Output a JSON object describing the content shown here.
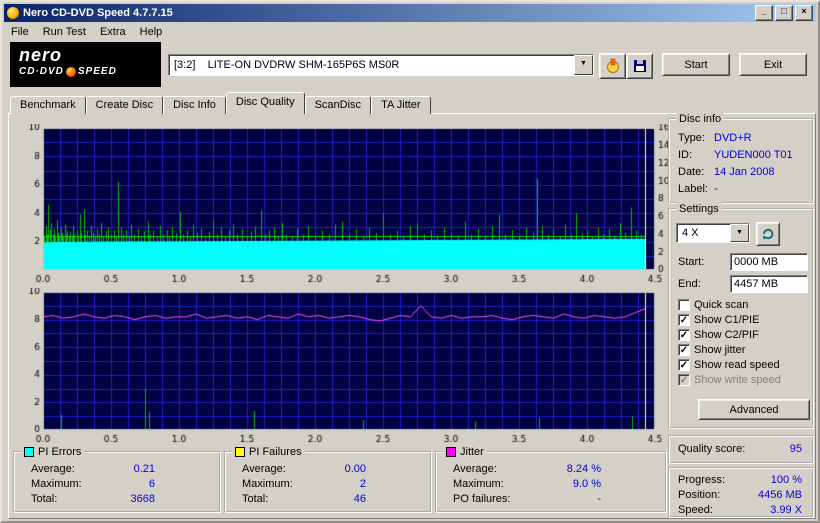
{
  "window": {
    "title": "Nero CD-DVD Speed 4.7.7.15",
    "controls": {
      "minimize": "_",
      "maximize": "□",
      "close": "×"
    }
  },
  "icons": {
    "dropdown": "▼",
    "check": "✓"
  },
  "menu": {
    "items": [
      "File",
      "Run Test",
      "Extra",
      "Help"
    ]
  },
  "logo": {
    "line1": "nero",
    "line2a": "CD·DVD",
    "line2b": "SPEED"
  },
  "toolbar": {
    "drive": "[3:2]    LITE-ON DVDRW SHM-165P6S MS0R",
    "start": "Start",
    "exit": "Exit"
  },
  "tabs": {
    "items": [
      "Benchmark",
      "Create Disc",
      "Disc Info",
      "Disc Quality",
      "ScanDisc",
      "TA Jitter"
    ],
    "active": "Disc Quality"
  },
  "disc_info": {
    "title": "Disc info",
    "rows": [
      [
        "Type:",
        "DVD+R"
      ],
      [
        "ID:",
        "YUDEN000 T01"
      ],
      [
        "Date:",
        "14 Jan 2008"
      ],
      [
        "Label:",
        "-"
      ]
    ]
  },
  "settings": {
    "title": "Settings",
    "speed": "4 X",
    "start_label": "Start:",
    "start_value": "0000 MB",
    "end_label": "End:",
    "end_value": "4457 MB",
    "checkboxes": [
      {
        "label": "Quick scan",
        "checked": false,
        "disabled": false
      },
      {
        "label": "Show C1/PIE",
        "checked": true,
        "disabled": false
      },
      {
        "label": "Show C2/PIF",
        "checked": true,
        "disabled": false
      },
      {
        "label": "Show jitter",
        "checked": true,
        "disabled": false
      },
      {
        "label": "Show read speed",
        "checked": true,
        "disabled": false
      },
      {
        "label": "Show write speed",
        "checked": true,
        "disabled": true
      }
    ],
    "advanced": "Advanced"
  },
  "quality": {
    "label": "Quality score:",
    "value": "95"
  },
  "progress": {
    "rows": [
      [
        "Progress:",
        "100 %"
      ],
      [
        "Position:",
        "4456 MB"
      ],
      [
        "Speed:",
        "3.99 X"
      ]
    ]
  },
  "stats": [
    {
      "title": "PI Errors",
      "swatch": "#00ffff",
      "rows": [
        [
          "Average:",
          "0.21"
        ],
        [
          "Maximum:",
          "6"
        ],
        [
          "Total:",
          "3668"
        ]
      ]
    },
    {
      "title": "PI Failures",
      "swatch": "#ffff00",
      "rows": [
        [
          "Average:",
          "0.00"
        ],
        [
          "Maximum:",
          "2"
        ],
        [
          "Total:",
          "46"
        ]
      ]
    },
    {
      "title": "Jitter",
      "swatch": "#ff00ff",
      "rows": [
        [
          "Average:",
          "8.24 %"
        ],
        [
          "Maximum:",
          "9.0 %"
        ],
        [
          "PO failures:",
          "-"
        ]
      ]
    }
  ],
  "chart_data": [
    {
      "type": "bar",
      "title": "PI Errors / read speed",
      "x_range": [
        0,
        4.5
      ],
      "y_left_range": [
        0,
        10
      ],
      "y_right_range": [
        0,
        16
      ],
      "x_ticks": [
        "0.0",
        "0.5",
        "1.0",
        "1.5",
        "2.0",
        "2.5",
        "3.0",
        "3.5",
        "4.0",
        "4.5"
      ],
      "left_ticks": [
        "10",
        "8",
        "6",
        "4",
        "2"
      ],
      "right_ticks": [
        "16",
        "14",
        "12",
        "10",
        "8",
        "6",
        "4",
        "2",
        "0"
      ],
      "grid_x_step": 0.125,
      "grid_y_step": 1,
      "colors": {
        "bg": "#000042",
        "grid": "#2020c8",
        "spike": "#00c000",
        "area": "#00ffff",
        "speed_line": "#00e400",
        "end_line": "#ffff99"
      },
      "scan_end_x": 4.43,
      "speed_line_y": 2.4,
      "read_speed_top": [
        [
          0,
          1.95
        ],
        [
          0.5,
          2.0
        ],
        [
          1.5,
          2.05
        ],
        [
          2.5,
          2.1
        ],
        [
          3.5,
          2.15
        ],
        [
          4.43,
          2.2
        ]
      ],
      "spikes": [
        [
          0.01,
          2.4
        ],
        [
          0.02,
          3.1
        ],
        [
          0.03,
          2.5
        ],
        [
          0.04,
          4.6
        ],
        [
          0.05,
          2.8
        ],
        [
          0.06,
          3.3
        ],
        [
          0.07,
          2.5
        ],
        [
          0.08,
          2.9
        ],
        [
          0.09,
          2.4
        ],
        [
          0.1,
          3.5
        ],
        [
          0.11,
          2.6
        ],
        [
          0.12,
          2.4
        ],
        [
          0.13,
          3.0
        ],
        [
          0.14,
          2.6
        ],
        [
          0.15,
          2.4
        ],
        [
          0.16,
          3.2
        ],
        [
          0.17,
          2.5
        ],
        [
          0.18,
          2.8
        ],
        [
          0.19,
          2.4
        ],
        [
          0.2,
          2.7
        ],
        [
          0.21,
          2.4
        ],
        [
          0.22,
          3.1
        ],
        [
          0.23,
          2.5
        ],
        [
          0.25,
          2.8
        ],
        [
          0.26,
          2.4
        ],
        [
          0.27,
          3.9
        ],
        [
          0.28,
          2.6
        ],
        [
          0.3,
          4.3
        ],
        [
          0.31,
          2.5
        ],
        [
          0.32,
          2.8
        ],
        [
          0.34,
          2.4
        ],
        [
          0.35,
          3.1
        ],
        [
          0.37,
          2.6
        ],
        [
          0.38,
          2.4
        ],
        [
          0.4,
          2.9
        ],
        [
          0.41,
          2.5
        ],
        [
          0.43,
          3.3
        ],
        [
          0.44,
          2.4
        ],
        [
          0.46,
          2.7
        ],
        [
          0.48,
          3.0
        ],
        [
          0.5,
          2.5
        ],
        [
          0.52,
          2.8
        ],
        [
          0.54,
          2.4
        ],
        [
          0.55,
          6.2
        ],
        [
          0.57,
          3.0
        ],
        [
          0.59,
          2.5
        ],
        [
          0.61,
          2.8
        ],
        [
          0.63,
          2.4
        ],
        [
          0.65,
          3.2
        ],
        [
          0.67,
          2.5
        ],
        [
          0.7,
          2.9
        ],
        [
          0.72,
          2.4
        ],
        [
          0.74,
          2.7
        ],
        [
          0.77,
          3.4
        ],
        [
          0.79,
          2.5
        ],
        [
          0.81,
          2.8
        ],
        [
          0.84,
          2.4
        ],
        [
          0.86,
          3.1
        ],
        [
          0.88,
          2.5
        ],
        [
          0.91,
          2.8
        ],
        [
          0.93,
          2.4
        ],
        [
          0.95,
          3.0
        ],
        [
          0.98,
          2.6
        ],
        [
          1.01,
          4.1
        ],
        [
          1.03,
          2.5
        ],
        [
          1.06,
          2.8
        ],
        [
          1.08,
          2.4
        ],
        [
          1.1,
          3.2
        ],
        [
          1.13,
          2.6
        ],
        [
          1.16,
          2.9
        ],
        [
          1.19,
          2.4
        ],
        [
          1.22,
          2.7
        ],
        [
          1.25,
          3.5
        ],
        [
          1.28,
          2.5
        ],
        [
          1.31,
          3.0
        ],
        [
          1.34,
          2.4
        ],
        [
          1.37,
          2.8
        ],
        [
          1.4,
          3.2
        ],
        [
          1.43,
          2.5
        ],
        [
          1.46,
          2.9
        ],
        [
          1.5,
          2.4
        ],
        [
          1.53,
          2.7
        ],
        [
          1.56,
          3.1
        ],
        [
          1.6,
          4.2
        ],
        [
          1.63,
          2.5
        ],
        [
          1.66,
          2.8
        ],
        [
          1.7,
          3.0
        ],
        [
          1.73,
          2.4
        ],
        [
          1.76,
          3.3
        ],
        [
          1.79,
          2.5
        ],
        [
          1.83,
          2.4
        ],
        [
          1.87,
          2.9
        ],
        [
          1.91,
          2.5
        ],
        [
          1.95,
          3.1
        ],
        [
          2.0,
          2.4
        ],
        [
          2.05,
          2.8
        ],
        [
          2.1,
          2.5
        ],
        [
          2.15,
          3.2
        ],
        [
          2.2,
          3.4
        ],
        [
          2.25,
          2.5
        ],
        [
          2.3,
          2.9
        ],
        [
          2.35,
          2.4
        ],
        [
          2.4,
          3.0
        ],
        [
          2.45,
          2.6
        ],
        [
          2.5,
          4.0
        ],
        [
          2.55,
          2.5
        ],
        [
          2.6,
          2.8
        ],
        [
          2.65,
          2.4
        ],
        [
          2.7,
          3.1
        ],
        [
          2.75,
          3.3
        ],
        [
          2.8,
          2.5
        ],
        [
          2.85,
          2.8
        ],
        [
          2.9,
          2.4
        ],
        [
          2.95,
          3.0
        ],
        [
          3.0,
          2.6
        ],
        [
          3.05,
          2.4
        ],
        [
          3.1,
          3.4
        ],
        [
          3.15,
          2.5
        ],
        [
          3.2,
          2.9
        ],
        [
          3.25,
          2.4
        ],
        [
          3.3,
          3.1
        ],
        [
          3.35,
          3.9
        ],
        [
          3.4,
          2.5
        ],
        [
          3.45,
          2.8
        ],
        [
          3.5,
          2.4
        ],
        [
          3.55,
          3.0
        ],
        [
          3.6,
          2.6
        ],
        [
          3.63,
          6.4
        ],
        [
          3.67,
          3.1
        ],
        [
          3.71,
          2.5
        ],
        [
          3.75,
          2.9
        ],
        [
          3.8,
          2.4
        ],
        [
          3.84,
          3.2
        ],
        [
          3.88,
          2.5
        ],
        [
          3.92,
          4.0
        ],
        [
          3.96,
          2.6
        ],
        [
          4.0,
          2.8
        ],
        [
          4.04,
          2.4
        ],
        [
          4.08,
          3.0
        ],
        [
          4.12,
          2.5
        ],
        [
          4.16,
          2.9
        ],
        [
          4.2,
          2.4
        ],
        [
          4.24,
          3.3
        ],
        [
          4.28,
          2.6
        ],
        [
          4.32,
          4.4
        ],
        [
          4.36,
          2.8
        ],
        [
          4.4,
          2.5
        ]
      ]
    },
    {
      "type": "line",
      "title": "Jitter / PI Failures",
      "x_range": [
        0,
        4.5
      ],
      "y_left_range": [
        0,
        10
      ],
      "x_ticks": [
        "0.0",
        "0.5",
        "1.0",
        "1.5",
        "2.0",
        "2.5",
        "3.0",
        "3.5",
        "4.0",
        "4.5"
      ],
      "left_ticks": [
        "10",
        "8",
        "6",
        "4",
        "2",
        "0"
      ],
      "grid_x_step": 0.125,
      "grid_y_step": 1,
      "colors": {
        "bg": "#000042",
        "grid": "#2020c8",
        "spike": "#00c000",
        "line": "#ff50ff",
        "end_line": "#ffff99"
      },
      "scan_end_x": 4.43,
      "jitter": {
        "x_start": 0,
        "x_end": 4.43,
        "values": [
          8.2,
          8.3,
          8.1,
          8.2,
          8.4,
          8.2,
          8.1,
          8.3,
          8.2,
          8.0,
          8.2,
          8.3,
          8.1,
          8.2,
          8.2,
          8.4,
          8.1,
          8.2,
          8.3,
          8.1,
          8.2,
          8.0,
          8.3,
          8.2,
          8.1,
          8.4,
          8.2,
          8.3,
          8.1,
          8.2,
          8.3,
          8.2,
          8.0,
          7.9,
          8.1,
          8.3,
          8.2,
          9.0,
          8.2,
          8.1,
          8.3,
          8.1,
          8.2,
          8.2,
          8.3,
          8.1,
          8.0,
          8.2,
          8.3,
          8.2,
          8.1,
          8.4,
          8.2,
          8.1,
          8.3,
          8.2,
          8.1,
          8.2,
          8.5,
          8.8
        ]
      },
      "spikes": [
        [
          0.13,
          1.1
        ],
        [
          0.75,
          3.0
        ],
        [
          0.78,
          1.3
        ],
        [
          1.55,
          1.4
        ],
        [
          2.35,
          0.7
        ],
        [
          3.18,
          0.6
        ],
        [
          3.65,
          0.9
        ],
        [
          4.33,
          1.0
        ]
      ]
    }
  ]
}
